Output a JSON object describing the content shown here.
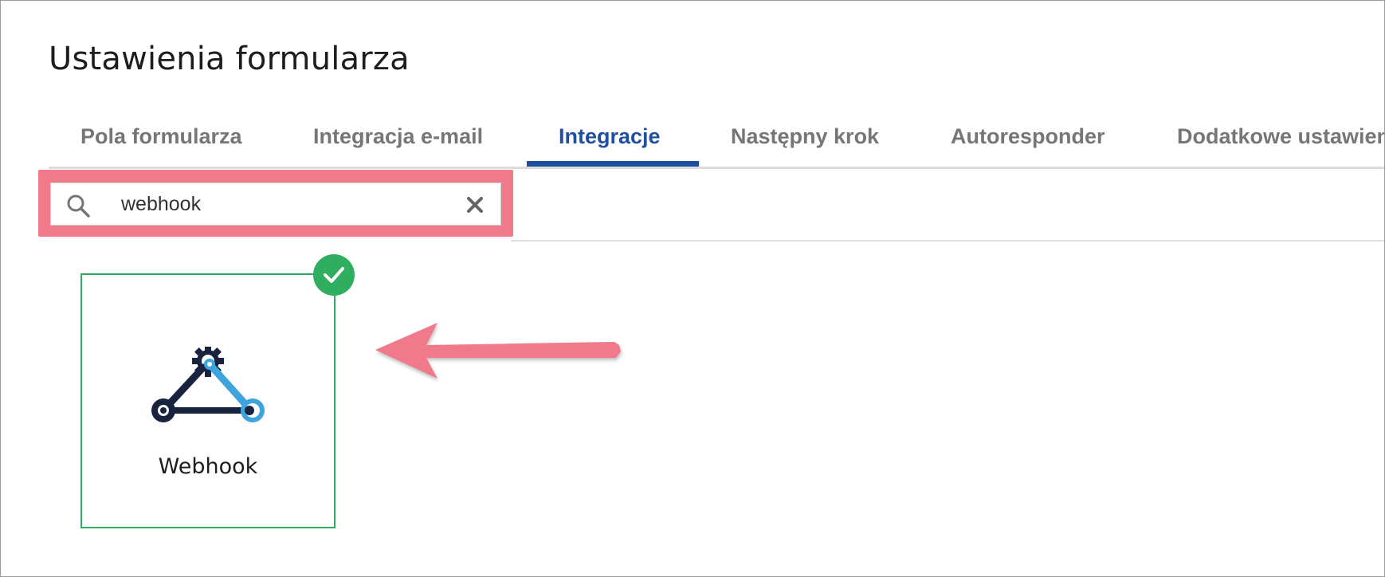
{
  "page": {
    "title": "Ustawienia formularza"
  },
  "tabs": [
    {
      "label": "Pola formularza",
      "active": false
    },
    {
      "label": "Integracja e-mail",
      "active": false
    },
    {
      "label": "Integracje",
      "active": true
    },
    {
      "label": "Następny krok",
      "active": false
    },
    {
      "label": "Autoresponder",
      "active": false
    },
    {
      "label": "Dodatkowe ustawienia",
      "active": false
    }
  ],
  "search": {
    "value": "webhook",
    "icon": "search-icon",
    "clear_icon": "close-icon"
  },
  "results": [
    {
      "label": "Webhook",
      "icon": "webhook-icon",
      "selected": true
    }
  ],
  "colors": {
    "accent": "#1f4fa0",
    "selected": "#2eae5e",
    "highlight": "#f07a8a",
    "logo_dark": "#17233f",
    "logo_light": "#3ea4dc"
  }
}
